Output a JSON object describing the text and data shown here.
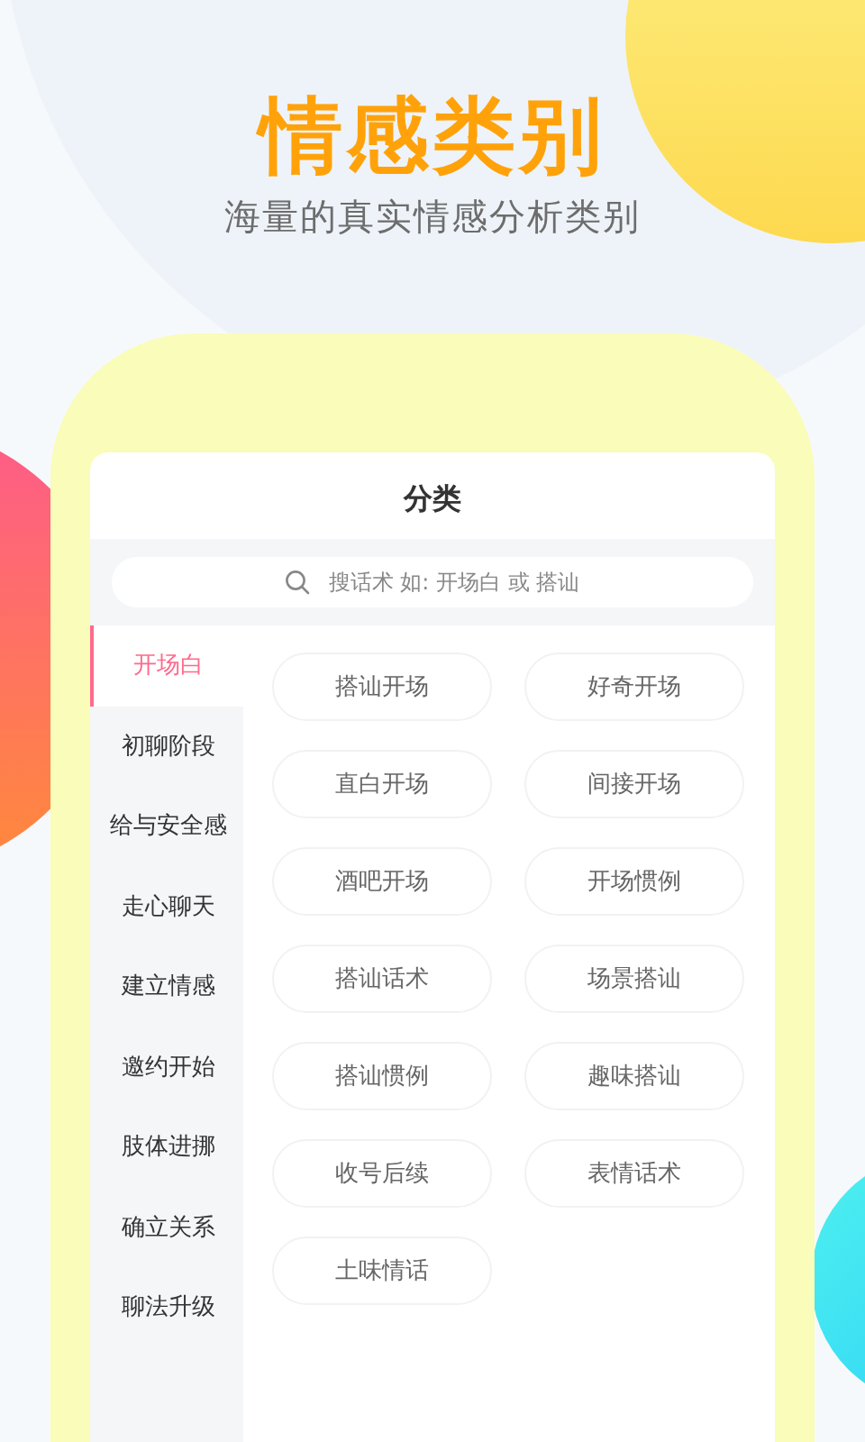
{
  "headline": "情感类别",
  "subtitle": "海量的真实情感分析类别",
  "screen": {
    "title": "分类",
    "search": {
      "placeholder": "搜话术 如: 开场白 或 搭讪"
    },
    "categories": [
      {
        "label": "开场白",
        "selected": true
      },
      {
        "label": "初聊阶段",
        "selected": false
      },
      {
        "label": "给与安全感",
        "selected": false
      },
      {
        "label": "走心聊天",
        "selected": false
      },
      {
        "label": "建立情感",
        "selected": false
      },
      {
        "label": "邀约开始",
        "selected": false
      },
      {
        "label": "肢体进挪",
        "selected": false
      },
      {
        "label": "确立关系",
        "selected": false
      },
      {
        "label": "聊法升级",
        "selected": false
      }
    ],
    "tags": [
      "搭讪开场",
      "好奇开场",
      "直白开场",
      "间接开场",
      "酒吧开场",
      "开场惯例",
      "搭讪话术",
      "场景搭讪",
      "搭讪惯例",
      "趣味搭讪",
      "收号后续",
      "表情话术",
      "土味情话"
    ]
  }
}
